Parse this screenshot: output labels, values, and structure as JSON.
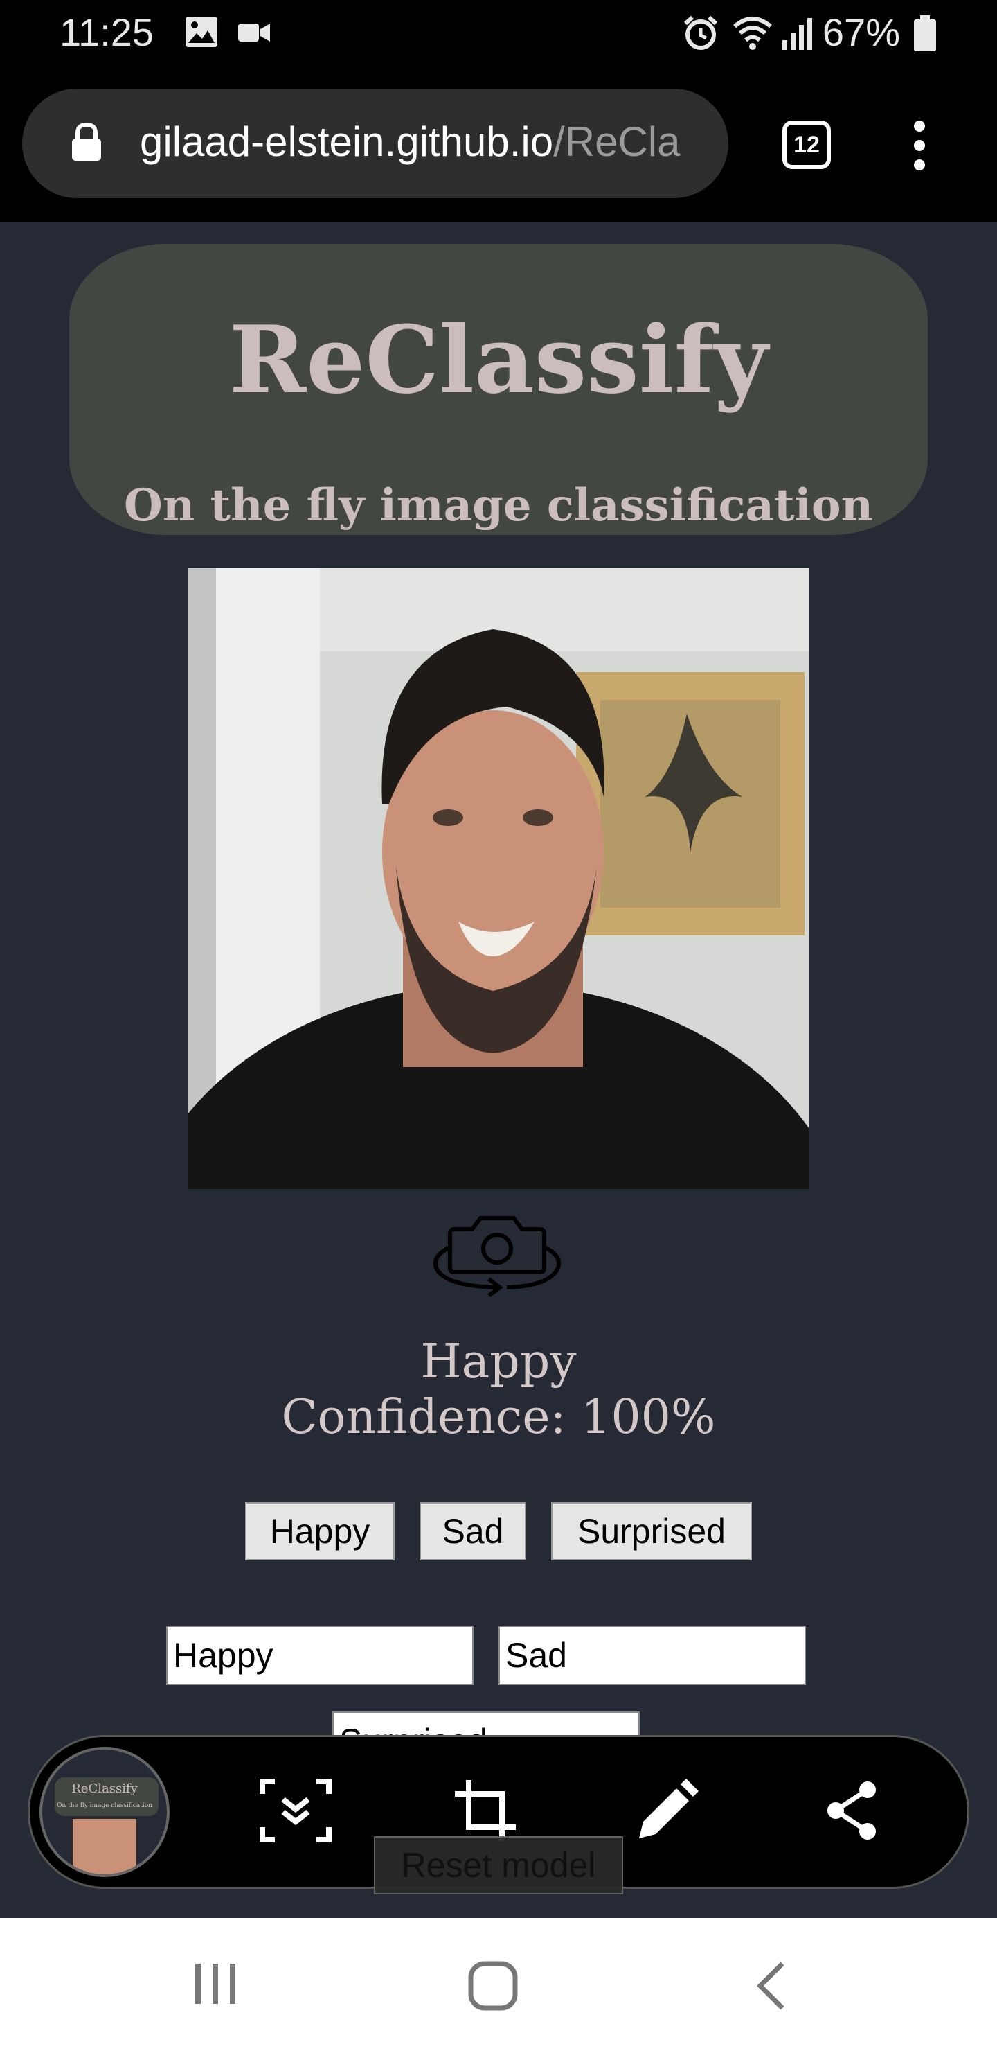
{
  "status_bar": {
    "time": "11:25",
    "battery_pct": "67%",
    "icons": [
      "image-icon",
      "video-icon",
      "alarm-icon",
      "wifi-icon",
      "signal-icon",
      "battery-icon"
    ]
  },
  "browser": {
    "url_host": "gilaad-elstein.github.io",
    "url_path": "/ReCla",
    "tab_count": "12"
  },
  "app": {
    "title": "ReClassify",
    "subtitle": "On the fly image classification"
  },
  "prediction": {
    "label": "Happy",
    "confidence_text": "Confidence: 100%"
  },
  "class_buttons": [
    "Happy",
    "Sad",
    "Surprised"
  ],
  "class_inputs": [
    "Happy",
    "Sad",
    "Surprised"
  ],
  "reset_button": "Reset model",
  "thumbnail": {
    "title": "ReClassify",
    "subtitle": "On the fly image classification"
  },
  "colors": {
    "page_bg": "#262a35",
    "header_bg": "#434741",
    "title_text": "#cbbcbe"
  }
}
